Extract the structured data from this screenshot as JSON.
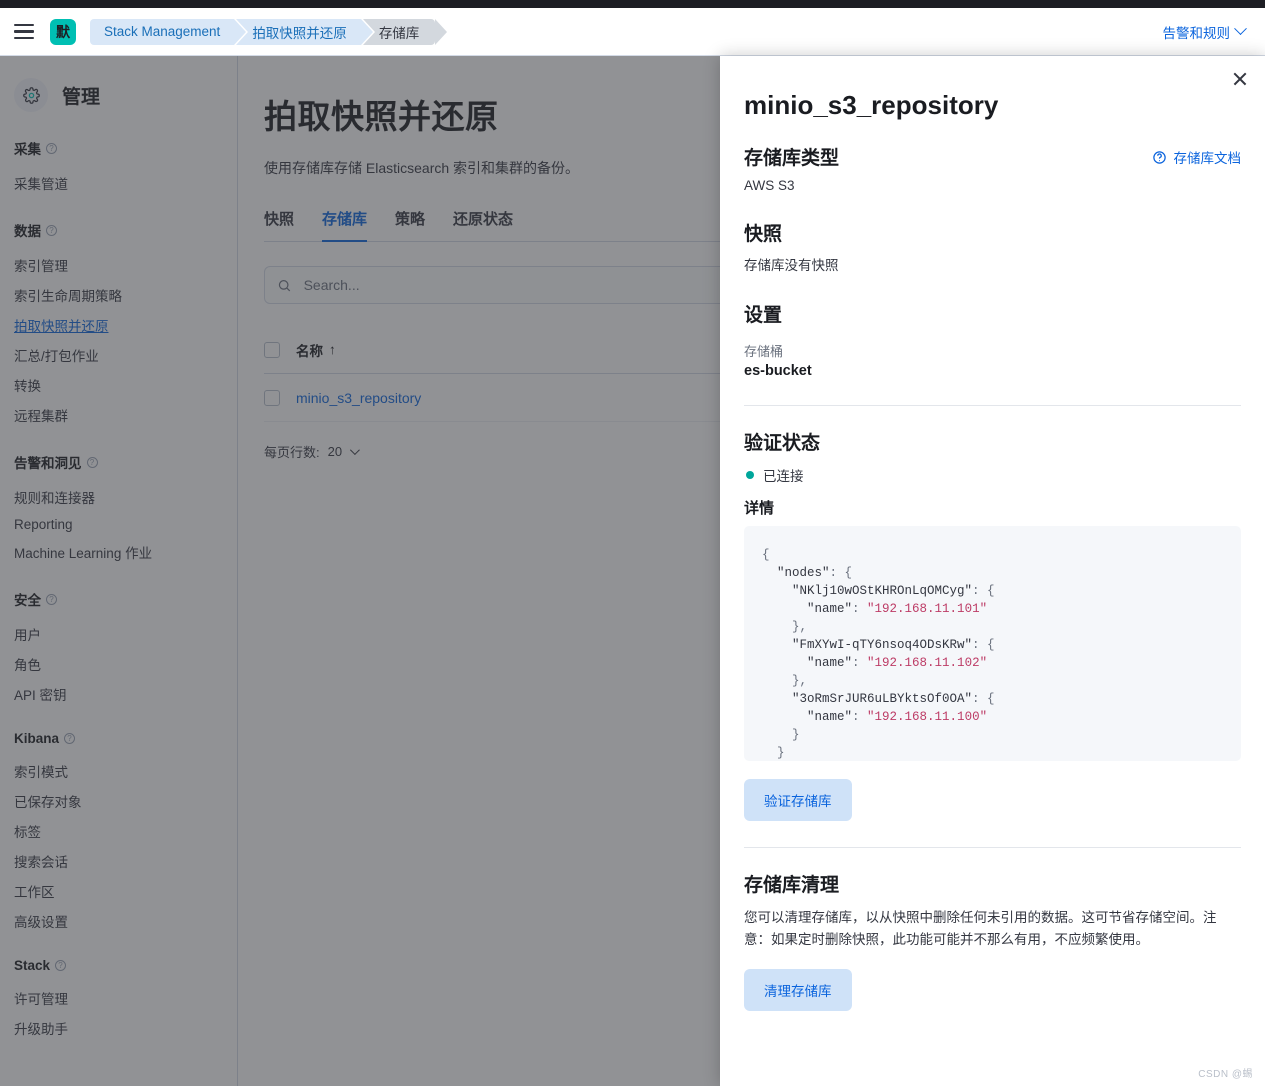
{
  "header": {
    "menu_icon": "hamburger-icon",
    "space_badge": "默",
    "breadcrumbs": [
      "Stack Management",
      "拍取快照并还原",
      "存储库"
    ],
    "right_link": "告警和规则"
  },
  "sidebar": {
    "title": "管理",
    "groups": [
      {
        "label": "采集",
        "items": [
          "采集管道"
        ]
      },
      {
        "label": "数据",
        "items": [
          "索引管理",
          "索引生命周期策略",
          "拍取快照并还原",
          "汇总/打包作业",
          "转换",
          "远程集群"
        ],
        "active": "拍取快照并还原"
      },
      {
        "label": "告警和洞见",
        "items": [
          "规则和连接器",
          "Reporting",
          "Machine Learning 作业"
        ]
      },
      {
        "label": "安全",
        "items": [
          "用户",
          "角色",
          "API 密钥"
        ]
      },
      {
        "label": "Kibana",
        "items": [
          "索引模式",
          "已保存对象",
          "标签",
          "搜索会话",
          "工作区",
          "高级设置"
        ]
      },
      {
        "label": "Stack",
        "items": [
          "许可管理",
          "升级助手"
        ]
      }
    ]
  },
  "main": {
    "title": "拍取快照并还原",
    "description": "使用存储库存储 Elasticsearch 索引和集群的备份。",
    "tabs": [
      "快照",
      "存储库",
      "策略",
      "还原状态"
    ],
    "active_tab": "存储库",
    "search_placeholder": "Search...",
    "search_value": "",
    "table": {
      "columns": [
        "名称"
      ],
      "sort_indicator": "↑",
      "rows": [
        {
          "name": "minio_s3_repository"
        }
      ]
    },
    "per_page_label": "每页行数:",
    "per_page_value": "20"
  },
  "flyout": {
    "title": "minio_s3_repository",
    "doc_link": "存储库文档",
    "type_heading": "存储库类型",
    "type_value": "AWS S3",
    "snapshot_heading": "快照",
    "snapshot_empty": "存储库没有快照",
    "settings_heading": "设置",
    "bucket_label": "存储桶",
    "bucket_value": "es-bucket",
    "verify_heading": "验证状态",
    "verify_status": "已连接",
    "details_heading": "详情",
    "details_json": "{\n  \"nodes\": {\n    \"NKlj10wOStKHROnLqOMCyg\": {\n      \"name\": \"192.168.11.101\"\n    },\n    \"FmXYwI-qTY6nsoq4ODsKRw\": {\n      \"name\": \"192.168.11.102\"\n    },\n    \"3oRmSrJUR6uLBYktsOf0OA\": {\n      \"name\": \"192.168.11.100\"\n    }\n  }\n}",
    "verify_button": "验证存储库",
    "cleanup_heading": "存储库清理",
    "cleanup_text": "您可以清理存储库，以从快照中删除任何未引用的数据。这可节省存储空间。注意：如果定时删除快照，此功能可能并不那么有用，不应频繁使用。",
    "cleanup_button": "清理存储库"
  },
  "colors": {
    "accent_blue": "#0b64dd",
    "teal": "#00bfb3",
    "status_green": "#00a69b",
    "string_red": "#bd3c66"
  },
  "watermark": "CSDN @蜴"
}
